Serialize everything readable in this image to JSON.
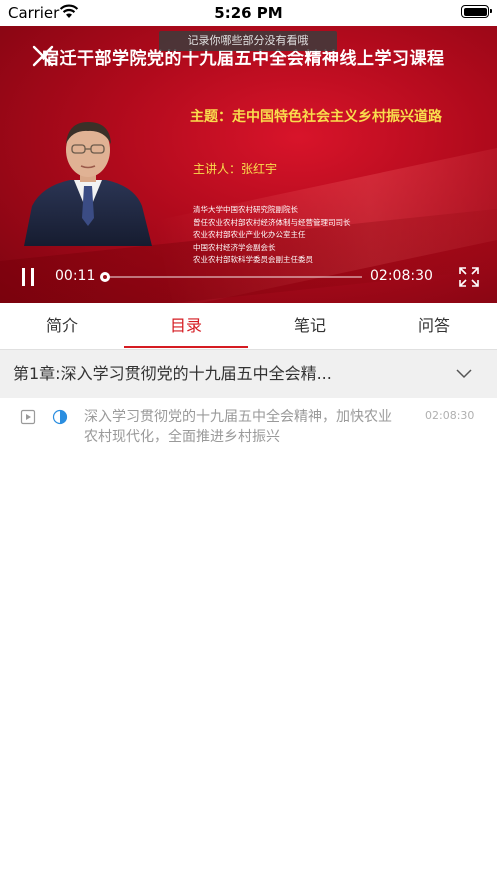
{
  "status_bar": {
    "carrier": "Carrier",
    "time": "5:26 PM"
  },
  "video": {
    "tooltip": "记录你哪些部分没有看哦",
    "title": "宿迁干部学院党的十九届五中全会精神线上学习课程",
    "topic": "主题：走中国特色社会主义乡村振兴道路",
    "speaker": "主讲人：张红宇",
    "bio": [
      "清华大学中国农村研究院副院长",
      "曾任农业农村部农村经济体制与经营管理司司长",
      "农业农村部农业产业化办公室主任",
      "中国农村经济学会副会长",
      "农业农村部软科学委员会副主任委员"
    ],
    "current_time": "00:11",
    "total_time": "02:08:30",
    "progress": 0.001
  },
  "tabs": [
    {
      "label": "简介",
      "active": false
    },
    {
      "label": "目录",
      "active": true
    },
    {
      "label": "笔记",
      "active": false
    },
    {
      "label": "问答",
      "active": false
    }
  ],
  "chapter": {
    "title": "第1章:深入学习贯彻党的十九届五中全会精..."
  },
  "lessons": [
    {
      "icon": "video-file-icon",
      "progress_icon": "half-circle-progress-icon",
      "title": "深入学习贯彻党的十九届五中全会精神，加快农业农村现代化，全面推进乡村振兴",
      "duration": "02:08:30"
    }
  ],
  "colors": {
    "accent": "#d51b22",
    "video_bg": "#b00a1c",
    "topic_yellow": "#f9dd4d"
  }
}
